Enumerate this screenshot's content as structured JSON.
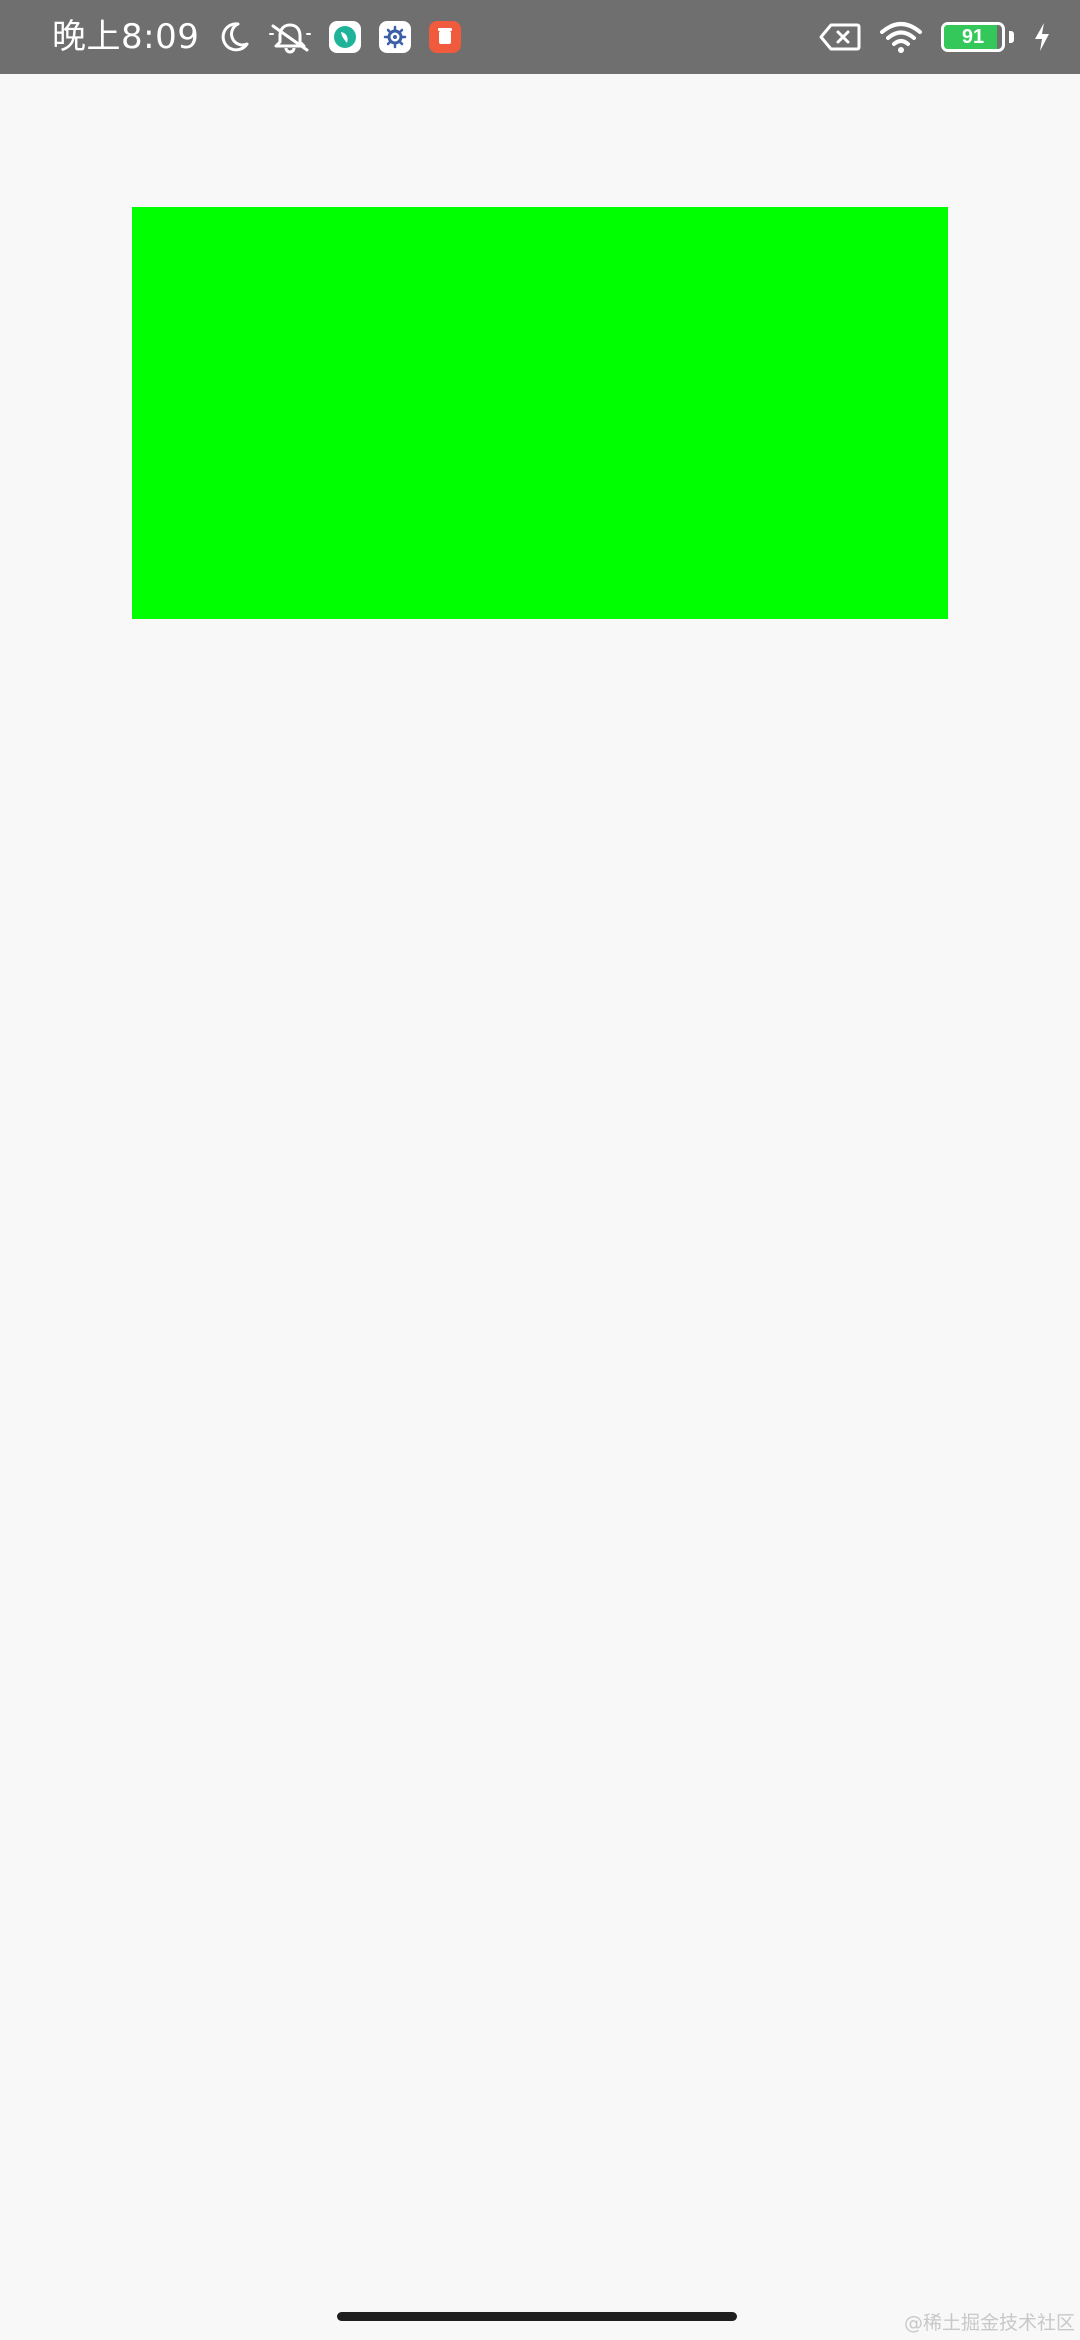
{
  "status_bar": {
    "time": "晚上8:09",
    "battery_level": 91,
    "battery_text": "91",
    "icons": [
      "moon-icon",
      "silent-bell-icon",
      "app-badge-green-icon",
      "app-badge-settings-icon",
      "app-badge-red-icon",
      "sim-x-icon",
      "wifi-icon",
      "battery-icon",
      "charging-bolt-icon"
    ],
    "colors": {
      "background": "#6f6f6f",
      "battery_fill": "#34c759",
      "badge_green": "#1fb49a",
      "badge_white": "#ffffff",
      "badge_red": "#f05a3d"
    }
  },
  "content": {
    "green_box_color": "#00ff00",
    "background_color": "#f8f8f8"
  },
  "watermark": {
    "text": "@稀土掘金技术社区"
  }
}
